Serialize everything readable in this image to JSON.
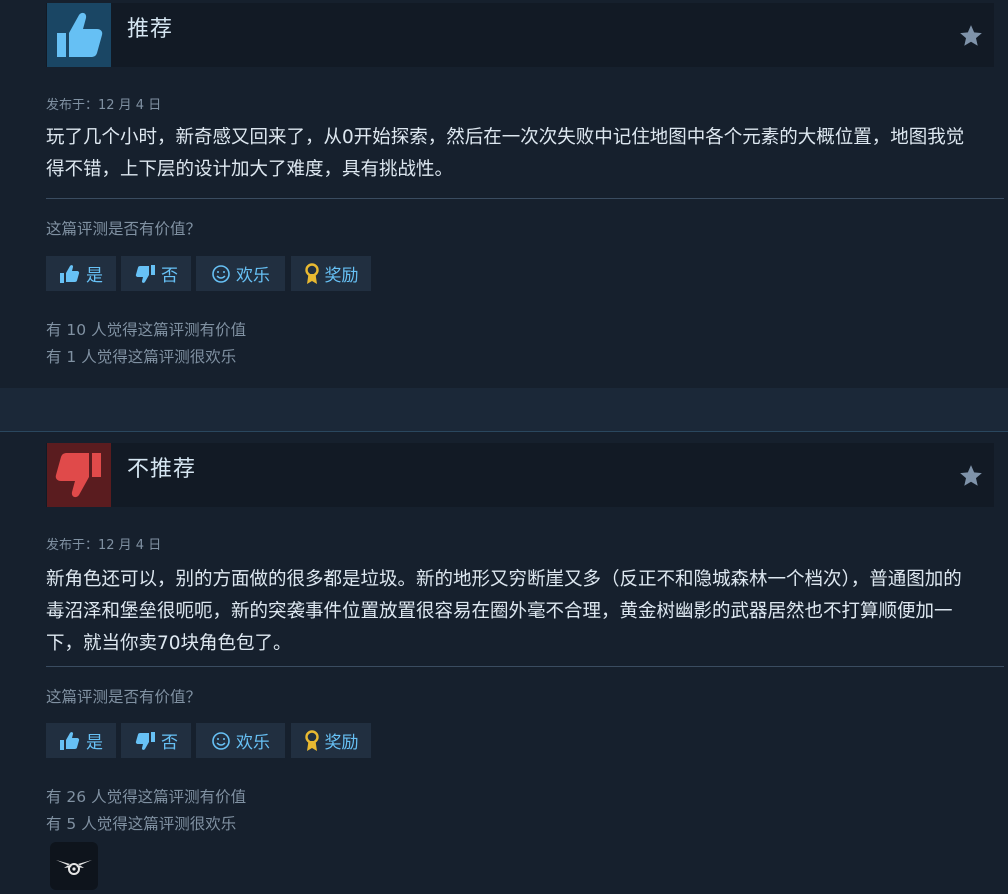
{
  "reviews": [
    {
      "title": "推荐",
      "posted": "发布于：12 月 4 日",
      "text": "玩了几个小时，新奇感又回来了，从0开始探索，然后在一次次失败中记住地图中各个元素的大概位置，地图我觉得不错，上下层的设计加大了难度，具有挑战性。",
      "question": "这篇评测是否有价值？",
      "buttons": {
        "yes": "是",
        "no": "否",
        "funny": "欢乐",
        "award": "奖励"
      },
      "helpful_count": "有 10 人觉得这篇评测有价值",
      "funny_count": "有 1 人觉得这篇评测很欢乐"
    },
    {
      "title": "不推荐",
      "posted": "发布于：12 月 4 日",
      "text": "新角色还可以，别的方面做的很多都是垃圾。新的地形又穷断崖又多（反正不和隐城森林一个档次），普通图加的毒沼泽和堡垒很呃呃，新的突袭事件位置放置很容易在圈外毫不合理，黄金树幽影的武器居然也不打算顺便加一下，就当你卖70块角色包了。",
      "question": "这篇评测是否有价值？",
      "buttons": {
        "yes": "是",
        "no": "否",
        "funny": "欢乐",
        "award": "奖励"
      },
      "helpful_count": "有 26 人觉得这篇评测有价值",
      "funny_count": "有 5 人觉得这篇评测很欢乐"
    }
  ],
  "colors": {
    "page_bg": "#1b2838",
    "card_bg": "#16202d",
    "link_blue": "#67c1f5",
    "recommend_bg": "#1a4664",
    "not_recommend_bg": "#5a1c1f",
    "muted_text": "#8091a2"
  },
  "icons": {
    "recommend": "thumbs-up-icon",
    "not_recommend": "thumbs-down-icon",
    "star": "star-icon",
    "funny": "smiley-icon",
    "award": "award-ribbon-icon",
    "badge": "winged-emblem-icon"
  }
}
